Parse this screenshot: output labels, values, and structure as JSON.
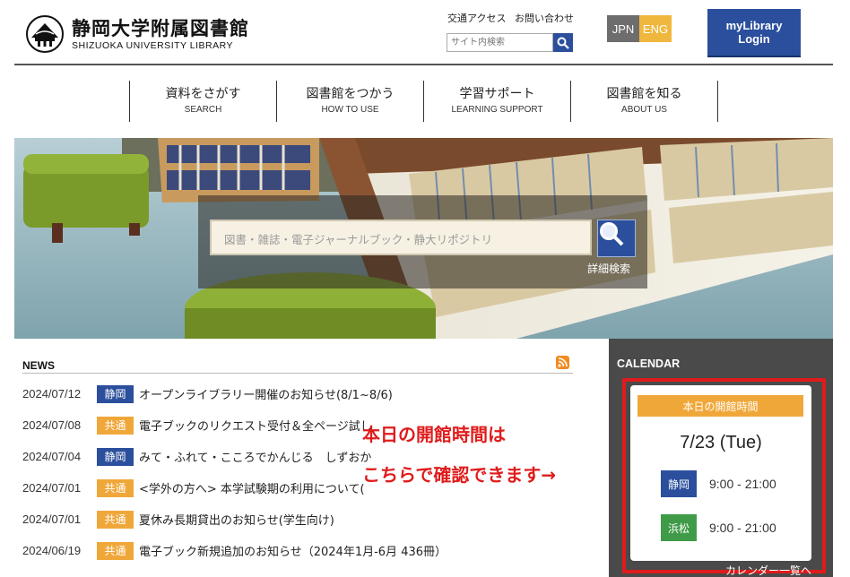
{
  "header": {
    "logo_ja": "静岡大学附属図書館",
    "logo_en": "SHIZUOKA UNIVERSITY LIBRARY",
    "util_links": [
      "交通アクセス",
      "お問い合わせ"
    ],
    "site_search_placeholder": "サイト内検索",
    "lang_jpn": "JPN",
    "lang_eng": "ENG",
    "mylibrary_line1": "myLibrary",
    "mylibrary_line2": "Login"
  },
  "nav": [
    {
      "ja": "資料をさがす",
      "en": "SEARCH"
    },
    {
      "ja": "図書館をつかう",
      "en": "HOW TO USE"
    },
    {
      "ja": "学習サポート",
      "en": "LEARNING SUPPORT"
    },
    {
      "ja": "図書館を知る",
      "en": "ABOUT US"
    }
  ],
  "hero": {
    "search_placeholder": "図書・雑誌・電子ジャーナルブック・静大リポジトリ",
    "advanced_search": "詳細検索"
  },
  "news": {
    "title": "NEWS",
    "items": [
      {
        "date": "2024/07/12",
        "campus": "静岡",
        "text": "オープンライブラリー開催のお知らせ(8/1~8/6)"
      },
      {
        "date": "2024/07/08",
        "campus": "共通",
        "text": "電子ブックのリクエスト受付＆全ページ試し"
      },
      {
        "date": "2024/07/04",
        "campus": "静岡",
        "text": "みて・ふれて・こころでかんじる　しずおか"
      },
      {
        "date": "2024/07/01",
        "campus": "共通",
        "text": "<学外の方へ> 本学試験期の利用について("
      },
      {
        "date": "2024/07/01",
        "campus": "共通",
        "text": "夏休み長期貸出のお知らせ(学生向け)"
      },
      {
        "date": "2024/06/19",
        "campus": "共通",
        "text": "電子ブック新規追加のお知らせ（2024年1月-6月 436冊）"
      }
    ]
  },
  "annotation": {
    "line1": "本日の開館時間は",
    "line2": "こちらで確認できます→"
  },
  "calendar": {
    "title": "CALENDAR",
    "today_label": "本日の開館時間",
    "date": "7/23 (Tue)",
    "hours": [
      {
        "campus": "静岡",
        "time": "9:00 - 21:00"
      },
      {
        "campus": "浜松",
        "time": "9:00 - 21:00"
      }
    ],
    "more_link": "カレンダー一覧へ"
  },
  "colors": {
    "brand_blue": "#2b4f9c",
    "accent_orange": "#f0a73a",
    "hamamatsu_green": "#3f9b48",
    "annotation_red": "#e01b1b"
  }
}
